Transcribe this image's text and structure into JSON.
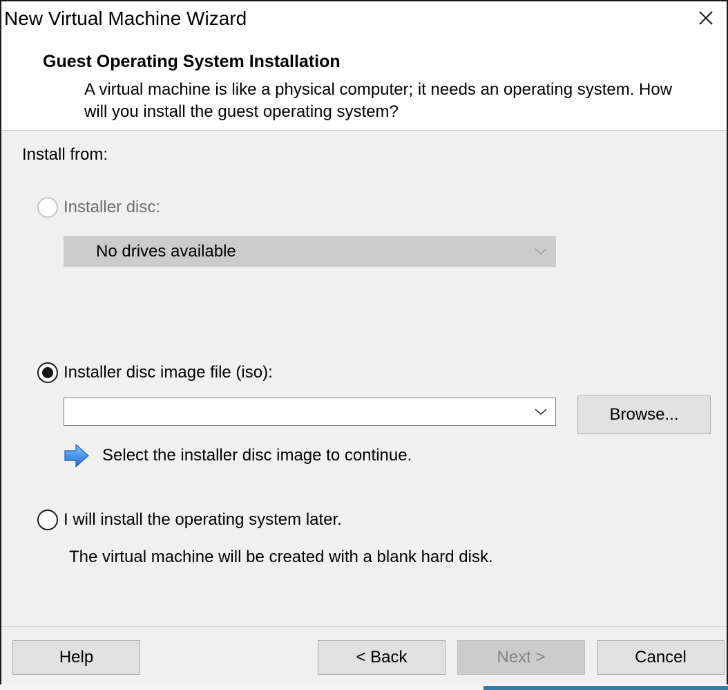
{
  "window": {
    "title": "New Virtual Machine Wizard"
  },
  "header": {
    "heading": "Guest Operating System Installation",
    "subtext": "A virtual machine is like a physical computer; it needs an operating system. How will you install the guest operating system?"
  },
  "body": {
    "install_from_label": "Install from:",
    "installer_disc": {
      "label": "Installer disc:",
      "enabled": false,
      "selected": false,
      "dropdown_value": "No drives available"
    },
    "iso_option": {
      "label": "Installer disc image file (iso):",
      "enabled": true,
      "selected": true,
      "path_value": "",
      "browse_label": "Browse...",
      "hint": "Select the installer disc image to continue."
    },
    "later_option": {
      "label": "I will install the operating system later.",
      "selected": false,
      "description": "The virtual machine will be created with a blank hard disk."
    }
  },
  "footer": {
    "help_label": "Help",
    "back_label": "< Back",
    "next_label": "Next >",
    "cancel_label": "Cancel"
  },
  "icons": {
    "close": "close-icon",
    "chevron": "chevron-down-icon",
    "hint_arrow": "arrow-right-icon"
  },
  "colors": {
    "dialog_bg": "#f0f0f0",
    "header_bg": "#ffffff",
    "disabled_control": "#cccccc",
    "button_face": "#e1e1e1",
    "hint_arrow_blue": "#3a8ee6"
  }
}
